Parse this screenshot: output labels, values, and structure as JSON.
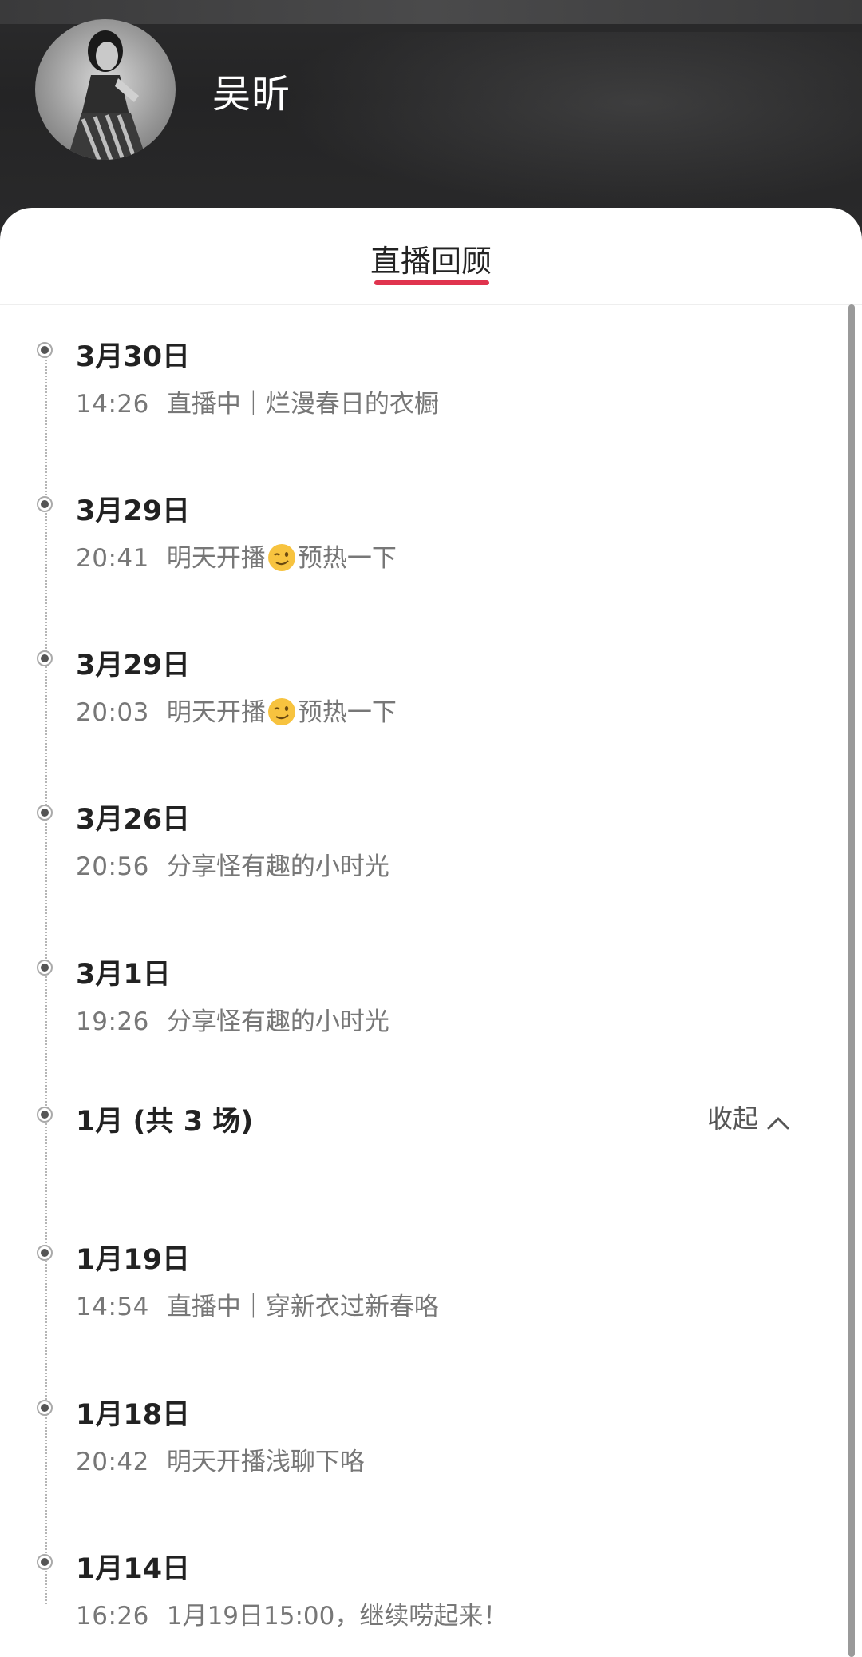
{
  "profile": {
    "name": "吴昕"
  },
  "tabs": {
    "active_label": "直播回顾"
  },
  "entries": [
    {
      "date": "3月30日",
      "time": "14:26",
      "title": "直播中｜烂漫春日的衣橱"
    },
    {
      "date": "3月29日",
      "time": "20:41",
      "title_before": "明天开播",
      "emoji": "wink-emoji",
      "title_after": "预热一下"
    },
    {
      "date": "3月29日",
      "time": "20:03",
      "title_before": "明天开播",
      "emoji": "wink-emoji",
      "title_after": "预热一下"
    },
    {
      "date": "3月26日",
      "time": "20:56",
      "title": "分享怪有趣的小时光"
    },
    {
      "date": "3月1日",
      "time": "19:26",
      "title": "分享怪有趣的小时光"
    }
  ],
  "month_group": {
    "label": "1月 (共 3 场)",
    "collapse_label": "收起"
  },
  "january_entries": [
    {
      "date": "1月19日",
      "time": "14:54",
      "title": "直播中｜穿新衣过新春咯"
    },
    {
      "date": "1月18日",
      "time": "20:42",
      "title": "明天开播浅聊下咯"
    },
    {
      "date": "1月14日",
      "time": "16:26",
      "title": "1月19日15:00，继续唠起来！"
    }
  ],
  "colors": {
    "accent_underline": "#e0344e",
    "header_bg": "#2a2a2b"
  }
}
